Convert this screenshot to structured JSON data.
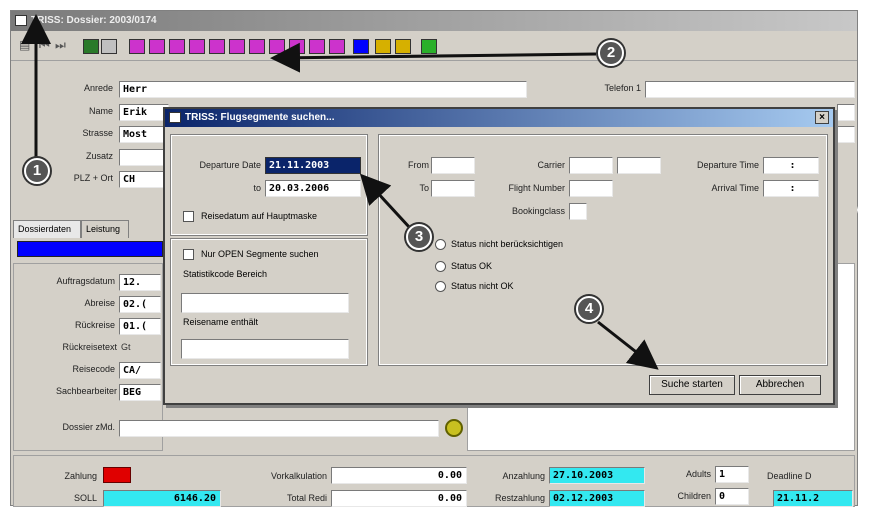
{
  "window": {
    "title": "TRISS: Dossier: 2003/0174"
  },
  "main": {
    "anrede": {
      "label": "Anrede",
      "value": "Herr"
    },
    "name": {
      "label": "Name",
      "value": "Erik"
    },
    "strasse": {
      "label": "Strasse",
      "value": "Most"
    },
    "zusatz": {
      "label": "Zusatz"
    },
    "plz": {
      "label": "PLZ + Ort",
      "value": "CH"
    },
    "telefon": {
      "label": "Telefon 1"
    },
    "tabs": [
      "Dossierdaten",
      "Leistung"
    ],
    "auftragsdatum": {
      "label": "Auftragsdatum",
      "value": "12."
    },
    "abreise": {
      "label": "Abreise",
      "value": "02.("
    },
    "rueckreise": {
      "label": "Rückreise",
      "value": "01.("
    },
    "rueckreisetext": {
      "label": "Rückreisetext",
      "value": "Gt"
    },
    "reisecode": {
      "label": "Reisecode",
      "value": "CA/"
    },
    "sachbearbeiter": {
      "label": "Sachbearbeiter",
      "value": "BEG"
    },
    "dossier_mld": {
      "label": "Dossier zMd."
    }
  },
  "bottom": {
    "zahlung": {
      "label": "Zahlung"
    },
    "soll": {
      "label": "SOLL",
      "value": "6146.20"
    },
    "vorkalkulation": {
      "label": "Vorkalkulation",
      "value": "0.00"
    },
    "total_red": {
      "label": "Total Redi",
      "value": "0.00"
    },
    "anzahlung": {
      "label": "Anzahlung",
      "value": "27.10.2003"
    },
    "restzahlung": {
      "label": "Restzahlung",
      "value": "02.12.2003"
    },
    "adults": {
      "label": "Adults",
      "value": "1"
    },
    "children": {
      "label": "Children",
      "value": "0"
    },
    "deadline": {
      "label": "Deadline D",
      "value": "21.11.2"
    }
  },
  "dialog": {
    "title": "TRISS: Flugsegmente suchen...",
    "close_label": "×",
    "departure_date": {
      "label": "Departure Date",
      "value": "21.11.2003"
    },
    "to_date": {
      "label": "to",
      "value": "20.03.2006"
    },
    "reisedatum_check": {
      "label": "Reisedatum auf Hauptmaske"
    },
    "nur_open": {
      "label": "Nur OPEN Segmente suchen"
    },
    "statistikcode": {
      "label": "Statistikcode Bereich"
    },
    "reisename": {
      "label": "Reisename enthält"
    },
    "from": {
      "label": "From"
    },
    "to": {
      "label": "To"
    },
    "carrier": {
      "label": "Carrier"
    },
    "flight_number": {
      "label": "Flight Number"
    },
    "booking_class": {
      "label": "Bookingclass"
    },
    "departure_time": {
      "label": "Departure Time",
      "value": ":"
    },
    "arrival_time": {
      "label": "Arrival Time",
      "value": ":"
    },
    "status_options": [
      "Status nicht berücksichtigen",
      "Status OK",
      "Status nicht OK"
    ],
    "search_button": "Suche starten",
    "cancel_button": "Abbrechen"
  },
  "callouts": [
    "1",
    "2",
    "3",
    "4"
  ],
  "colors": {
    "accent": "#0a246a",
    "cyan": "#33e8f0",
    "magenta": "#cc33cc",
    "blue": "#0000ff",
    "red": "#e00000"
  }
}
